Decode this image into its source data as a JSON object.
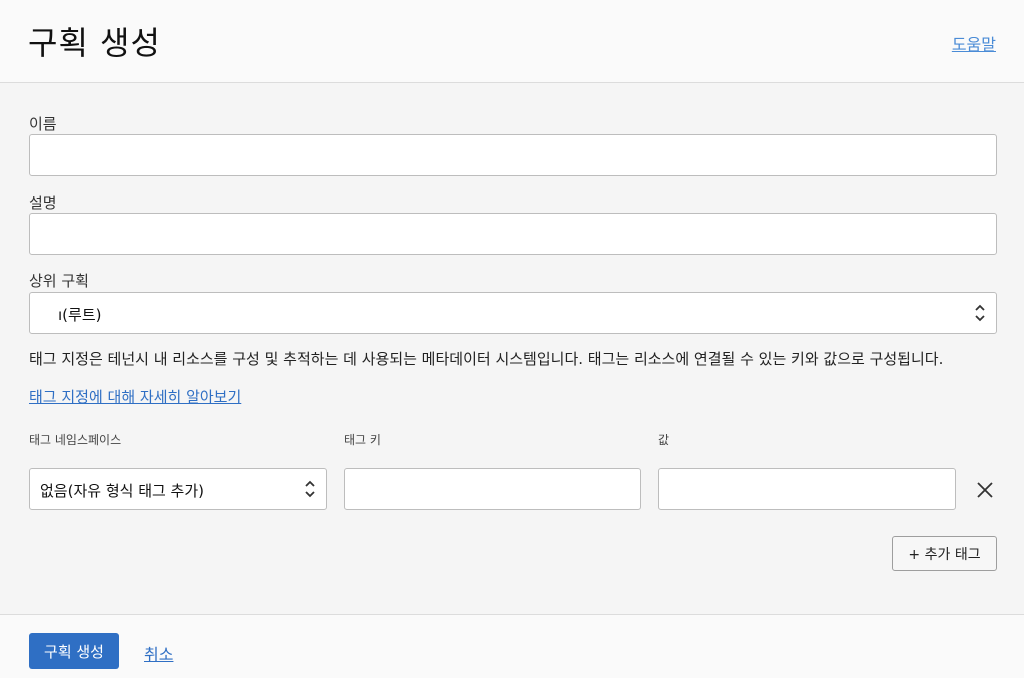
{
  "header": {
    "title": "구획 생성",
    "help_link": "도움말"
  },
  "form": {
    "name": {
      "label": "이름",
      "value": ""
    },
    "description": {
      "label": "설명",
      "value": ""
    },
    "parent": {
      "label": "상위 구획",
      "selected": "ı(루트)"
    }
  },
  "tags": {
    "description": "태그 지정은 테넌시 내 리소스를 구성 및 추적하는 데 사용되는 메타데이터 시스템입니다. 태그는 리소스에 연결될 수 있는 키와 값으로 구성됩니다.",
    "learn_more": "태그 지정에 대해 자세히 알아보기",
    "columns": {
      "namespace": "태그 네임스페이스",
      "key": "태그 키",
      "value": "값"
    },
    "row": {
      "namespace_selected": "없음(자유 형식 태그 추가)",
      "key_value": "",
      "value_value": ""
    },
    "add_button": "+ 추가 태그"
  },
  "footer": {
    "create_button": "구획 생성",
    "cancel_link": "취소"
  },
  "colors": {
    "accent": "#2f6fc4",
    "link": "#4a8bd6"
  }
}
